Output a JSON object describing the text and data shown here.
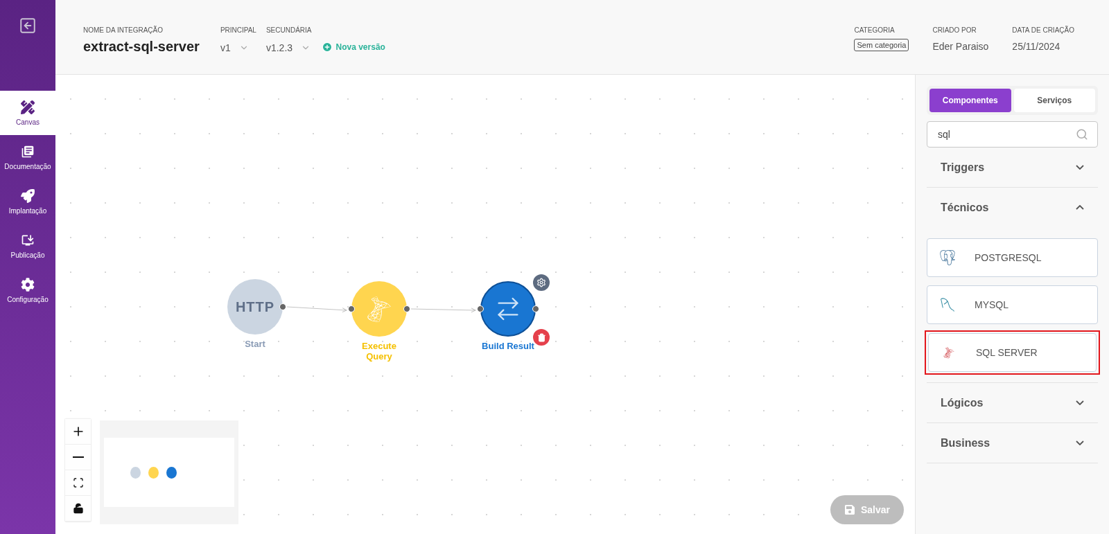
{
  "sidebar": {
    "items": [
      {
        "kind": "canvas",
        "label": "Canvas",
        "selected": true
      },
      {
        "kind": "docs",
        "label": "Documentação",
        "selected": false
      },
      {
        "kind": "deploy",
        "label": "Implantação",
        "selected": false
      },
      {
        "kind": "publish",
        "label": "Publicação",
        "selected": false
      },
      {
        "kind": "settings",
        "label": "Configuração",
        "selected": false
      }
    ]
  },
  "header": {
    "name": {
      "label": "NOME DA INTEGRAÇÃO",
      "value": "extract-sql-server"
    },
    "versions": [
      {
        "label": "PRINCIPAL",
        "value": "v1"
      },
      {
        "label": "SECUNDÁRIA",
        "value": "v1.2.3"
      }
    ],
    "new_version": "Nova versão",
    "meta": [
      {
        "kind": "tag",
        "label": "CATEGORIA",
        "value": "Sem categoria"
      },
      {
        "kind": "text",
        "label": "CRIADO POR",
        "value": "Eder Paraiso"
      },
      {
        "kind": "text",
        "label": "DATA DE CRIAÇÃO",
        "value": "25/11/2024"
      }
    ]
  },
  "canvas": {
    "nodes": [
      {
        "kind": "http",
        "badge": "HTTP",
        "label": "Start",
        "color": "#cbd5e1",
        "selected": false
      },
      {
        "kind": "sqlserver",
        "label": "Execute Query",
        "color": "#ffd54f",
        "selected": false
      },
      {
        "kind": "transform",
        "label": "Build Result",
        "color": "#1976d2",
        "selected": true
      }
    ],
    "locked": false,
    "save": {
      "label": "Salvar",
      "disabled": true
    }
  },
  "panel": {
    "tabs": [
      {
        "label": "Componentes",
        "selected": true
      },
      {
        "label": "Serviços",
        "selected": false
      }
    ],
    "search": {
      "value": "sql"
    },
    "sections": [
      {
        "title": "Triggers",
        "expanded": false
      },
      {
        "title": "Técnicos",
        "expanded": true,
        "items": [
          {
            "kind": "postgres",
            "label": "POSTGRESQL",
            "highlighted": false
          },
          {
            "kind": "mysql",
            "label": "MYSQL",
            "highlighted": false
          },
          {
            "kind": "sqlserver",
            "label": "SQL SERVER",
            "highlighted": true
          }
        ]
      },
      {
        "title": "Lógicos",
        "expanded": false
      },
      {
        "title": "Business",
        "expanded": false
      }
    ]
  }
}
